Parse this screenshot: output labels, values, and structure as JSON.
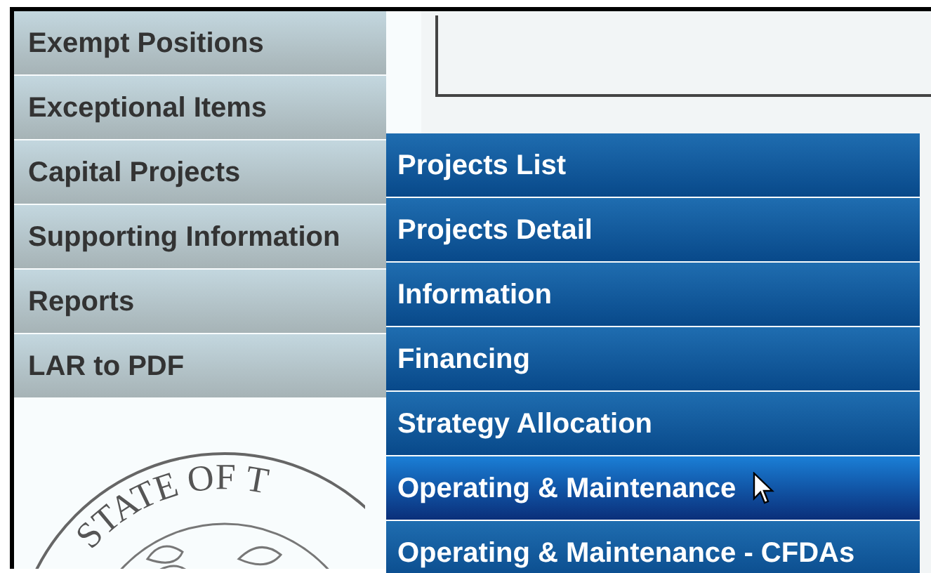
{
  "menu": [
    {
      "label": "Exempt Positions"
    },
    {
      "label": "Exceptional Items"
    },
    {
      "label": "Capital Projects"
    },
    {
      "label": "Supporting Information"
    },
    {
      "label": "Reports"
    },
    {
      "label": "LAR to PDF"
    }
  ],
  "submenu": [
    {
      "label": "Projects List",
      "selected": false
    },
    {
      "label": "Projects Detail",
      "selected": false
    },
    {
      "label": "Information",
      "selected": false
    },
    {
      "label": "Financing",
      "selected": false
    },
    {
      "label": "Strategy Allocation",
      "selected": false
    },
    {
      "label": "Operating & Maintenance",
      "selected": true
    },
    {
      "label": "Operating & Maintenance - CFDAs",
      "selected": false
    }
  ],
  "seal": {
    "text": "STATE OF T"
  }
}
